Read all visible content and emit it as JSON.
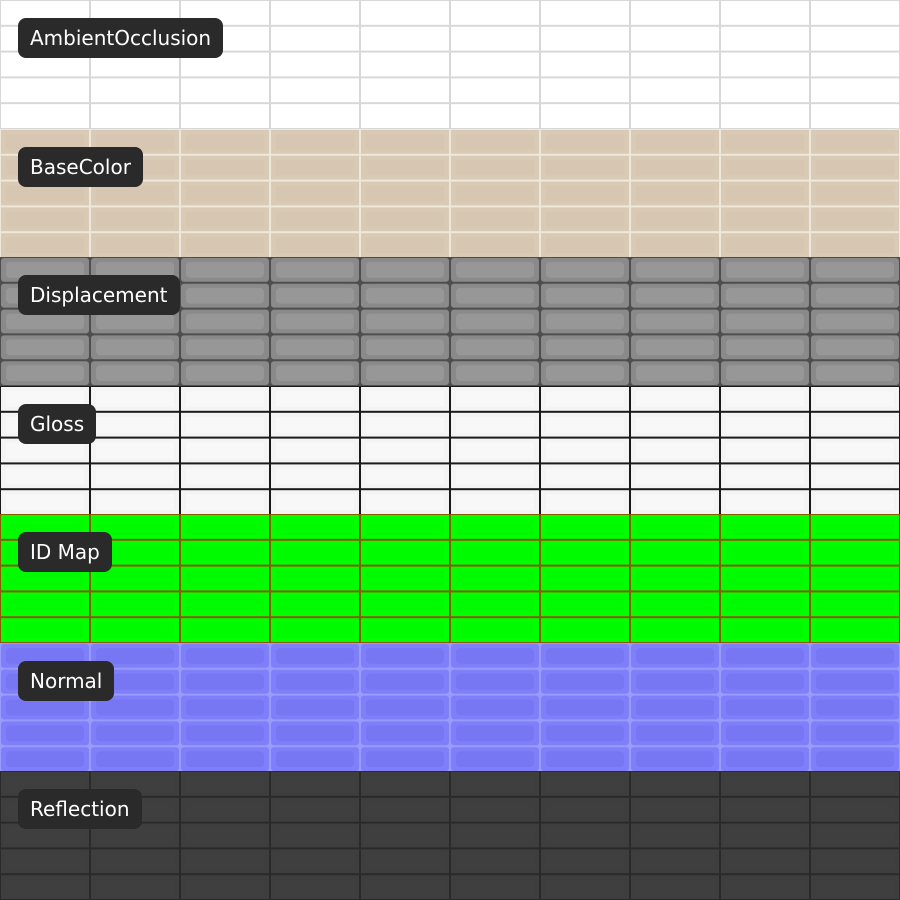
{
  "maps": [
    {
      "name": "AmbientOcclusion",
      "fill": "#ffffff",
      "grout": "#d8d8d8",
      "inner": "#ffffff",
      "style": "flat",
      "tile_color": "white"
    },
    {
      "name": "BaseColor",
      "fill": "#d9cab6",
      "grout": "#efe7dc",
      "inner": "#d3c3ad",
      "style": "flat",
      "tile_color": "beige"
    },
    {
      "name": "Displacement",
      "fill": "#8a8a8a",
      "grout": "#4e4e4e",
      "inner": "#9c9c9c",
      "style": "soft",
      "tile_color": "gray"
    },
    {
      "name": "Gloss",
      "fill": "#f4f4f4",
      "grout": "#1a1a1a",
      "inner": "#ffffff",
      "style": "flat",
      "tile_color": "white"
    },
    {
      "name": "ID Map",
      "fill": "#00ff00",
      "grout": "#8a5a00",
      "inner": "#00f000",
      "style": "flat",
      "tile_color": "green"
    },
    {
      "name": "Normal",
      "fill": "#7f7ff9",
      "grout": "#9a9aff",
      "inner": "#7474f2",
      "style": "soft",
      "tile_color": "blue-violet"
    },
    {
      "name": "Reflection",
      "fill": "#3e3e3e",
      "grout": "#2a2a2a",
      "inner": "#424242",
      "style": "flat",
      "tile_color": "dark-gray"
    }
  ]
}
